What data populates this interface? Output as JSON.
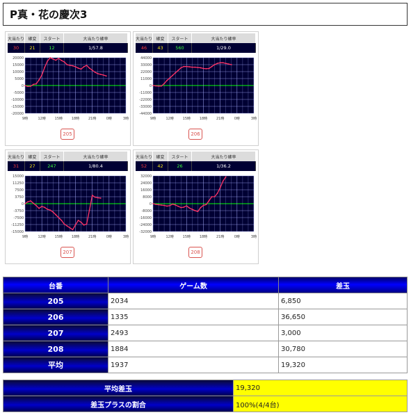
{
  "page": {
    "title": "P真・花の慶次3"
  },
  "stat_headers": [
    "大当たり",
    "確変",
    "スタート",
    "大当たり確率"
  ],
  "chart_data": [
    {
      "type": "line",
      "machine": "205",
      "stats": {
        "jackpots": "30",
        "kakuhen": "21",
        "start": "12",
        "probability": "1/57.8"
      },
      "yticks": [
        "20000",
        "15000",
        "10000",
        "5000",
        "0",
        "-5000",
        "-10000",
        "-15000",
        "-20000"
      ],
      "ylim": [
        -20000,
        20000
      ],
      "xticks": [
        "9時",
        "12時",
        "15時",
        "18時",
        "21時",
        "0時",
        "3時"
      ],
      "x": [
        9,
        9.5,
        10,
        10.5,
        11,
        11.5,
        12,
        12.5,
        13,
        13.5,
        14,
        14.5,
        15,
        15.5,
        16,
        16.5,
        17,
        17.5,
        18,
        18.5,
        19,
        19.5,
        20,
        20.5,
        21,
        21.5,
        22,
        22.5,
        23,
        23.5
      ],
      "values": [
        -100,
        -600,
        -500,
        800,
        1200,
        4000,
        7500,
        13000,
        17500,
        20000,
        19000,
        18200,
        19500,
        18000,
        17000,
        15000,
        14500,
        14200,
        13500,
        12500,
        11800,
        13500,
        14500,
        12500,
        11000,
        9500,
        8500,
        8000,
        7500,
        6850
      ],
      "button": "205"
    },
    {
      "type": "line",
      "machine": "206",
      "stats": {
        "jackpots": "46",
        "kakuhen": "43",
        "start": "560",
        "probability": "1/29.0"
      },
      "yticks": [
        "44000",
        "33000",
        "22000",
        "11000",
        "0",
        "-11000",
        "-22000",
        "-33000",
        "-44000"
      ],
      "ylim": [
        -44000,
        44000
      ],
      "xticks": [
        "9時",
        "12時",
        "15時",
        "18時",
        "21時",
        "0時",
        "3時"
      ],
      "x": [
        9,
        9.5,
        10,
        10.5,
        11,
        11.5,
        12,
        12.5,
        13,
        13.5,
        14,
        14.5,
        15,
        15.5,
        16,
        16.5,
        17,
        17.5,
        18,
        18.5,
        19,
        19.5,
        20,
        20.5,
        21,
        21.5,
        22,
        22.5,
        23
      ],
      "values": [
        0,
        -600,
        -1000,
        -800,
        3000,
        8000,
        12000,
        16000,
        20000,
        24000,
        28000,
        30000,
        30000,
        29500,
        29000,
        29000,
        28500,
        28000,
        27000,
        26500,
        27000,
        30000,
        33000,
        35000,
        36000,
        36000,
        35000,
        34000,
        33000
      ],
      "button": "206"
    },
    {
      "type": "line",
      "machine": "207",
      "stats": {
        "jackpots": "31",
        "kakuhen": "27",
        "start": "247",
        "probability": "1/80.4"
      },
      "yticks": [
        "15000",
        "11250",
        "7500",
        "3750",
        "0",
        "-3750",
        "-7500",
        "-11250",
        "-15000"
      ],
      "ylim": [
        -15000,
        15000
      ],
      "xticks": [
        "9時",
        "12時",
        "15時",
        "18時",
        "21時",
        "0時",
        "3時"
      ],
      "x": [
        9,
        9.5,
        10,
        10.5,
        11,
        11.5,
        12,
        12.5,
        13,
        13.5,
        14,
        14.5,
        15,
        15.5,
        16,
        16.5,
        17,
        17.5,
        18,
        18.5,
        19,
        19.5,
        20,
        20.5,
        21,
        21.5,
        22,
        22.5
      ],
      "values": [
        0,
        1000,
        1500,
        200,
        -1000,
        -2500,
        -1500,
        -2000,
        -3000,
        -3500,
        -4500,
        -6000,
        -7500,
        -9000,
        -11000,
        -12000,
        -13000,
        -14000,
        -11500,
        -9000,
        -10000,
        -11500,
        -11000,
        -3500,
        4500,
        3500,
        3200,
        3000
      ],
      "button": "207"
    },
    {
      "type": "line",
      "machine": "208",
      "stats": {
        "jackpots": "52",
        "kakuhen": "42",
        "start": "26",
        "probability": "1/36.2"
      },
      "yticks": [
        "32000",
        "24000",
        "16000",
        "8000",
        "0",
        "-8000",
        "-16000",
        "-24000",
        "-32000"
      ],
      "ylim": [
        -32000,
        32000
      ],
      "xticks": [
        "9時",
        "12時",
        "15時",
        "18時",
        "21時",
        "0時",
        "3時"
      ],
      "x": [
        9,
        9.5,
        10,
        10.5,
        11,
        11.5,
        12,
        12.5,
        13,
        13.5,
        14,
        14.5,
        15,
        15.5,
        16,
        16.5,
        17,
        17.5,
        18,
        18.5,
        19,
        19.5,
        20,
        20.5,
        21,
        21.5,
        22
      ],
      "values": [
        0,
        -800,
        -1200,
        -1600,
        -2000,
        -2800,
        -2200,
        -500,
        -1500,
        -3000,
        -4500,
        -4000,
        -2500,
        -5000,
        -6500,
        -8000,
        -9000,
        -4500,
        -2000,
        -1000,
        3500,
        8000,
        8000,
        12000,
        18500,
        26000,
        30780
      ],
      "button": "208"
    }
  ],
  "summary": {
    "headers": [
      "台番",
      "ゲーム数",
      "差玉"
    ],
    "rows": [
      {
        "label": "205",
        "games": "2034",
        "diff": "6,850"
      },
      {
        "label": "206",
        "games": "1335",
        "diff": "36,650"
      },
      {
        "label": "207",
        "games": "2493",
        "diff": "3,000"
      },
      {
        "label": "208",
        "games": "1884",
        "diff": "30,780"
      },
      {
        "label": "平均",
        "games": "1937",
        "diff": "19,320"
      }
    ]
  },
  "totals": [
    {
      "label": "平均差玉",
      "value": "19,320"
    },
    {
      "label": "差玉プラスの割合",
      "value": "100%(4/4台)"
    }
  ],
  "colors": {
    "plot_bg": "#000033",
    "line": "#ff3366",
    "grid": "#aab0ff",
    "zero_line": "#00ff00"
  }
}
